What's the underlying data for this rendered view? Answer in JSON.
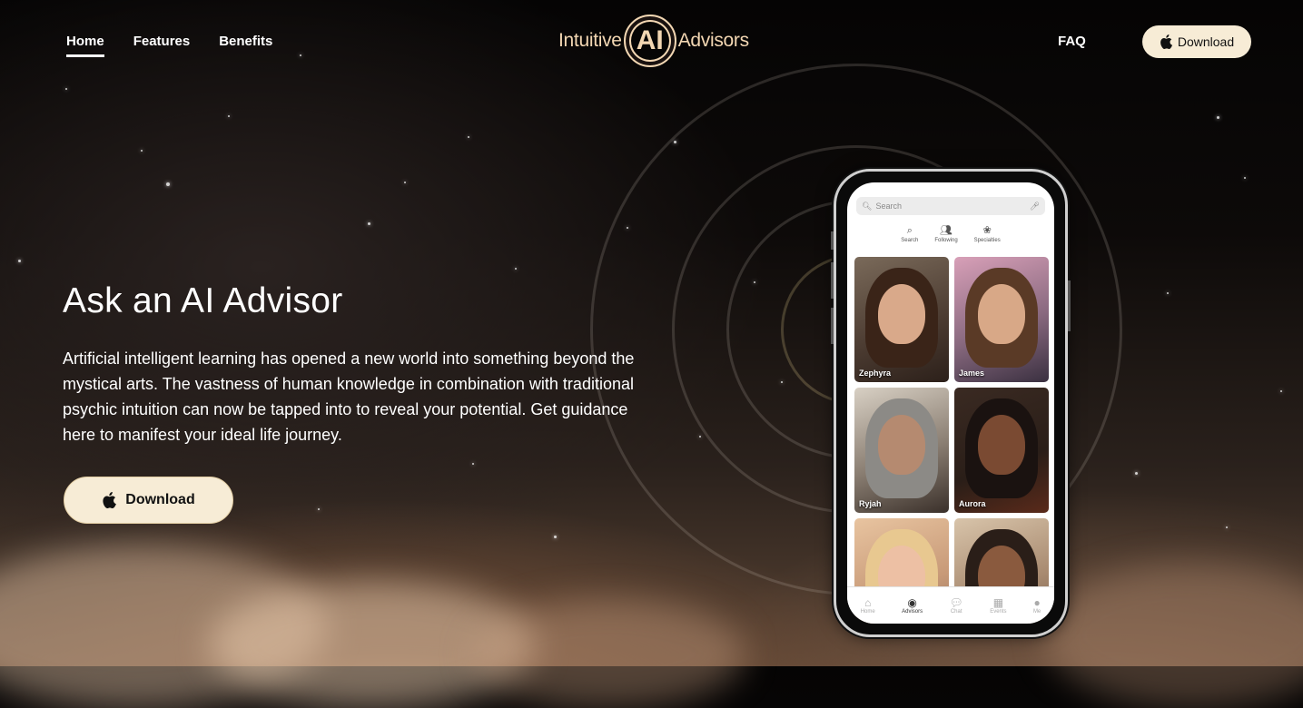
{
  "nav": {
    "home": "Home",
    "features": "Features",
    "benefits": "Benefits",
    "faq": "FAQ",
    "download": "Download"
  },
  "logo": {
    "left": "Intuitive",
    "center": "AI",
    "right": "Advisors"
  },
  "hero": {
    "title": "Ask an AI Advisor",
    "text": "Artificial intelligent learning has opened a new world into something beyond the mystical arts. The vastness of human knowledge in combination with traditional psychic intuition can now be tapped into to reveal your potential. Get guidance here to manifest your ideal life journey.",
    "download": "Download"
  },
  "phone": {
    "search_placeholder": "Search",
    "tabs": [
      "Search",
      "Following",
      "Specialties"
    ],
    "advisors": [
      "Zephyra",
      "James",
      "Ryjah",
      "Aurora",
      "",
      ""
    ],
    "bottom_nav": [
      "Home",
      "Advisors",
      "Chat",
      "Events",
      "Me"
    ],
    "active_bottom": "Advisors"
  },
  "colors": {
    "accent": "#f3d7b3",
    "button_bg": "#f7ecd6"
  }
}
